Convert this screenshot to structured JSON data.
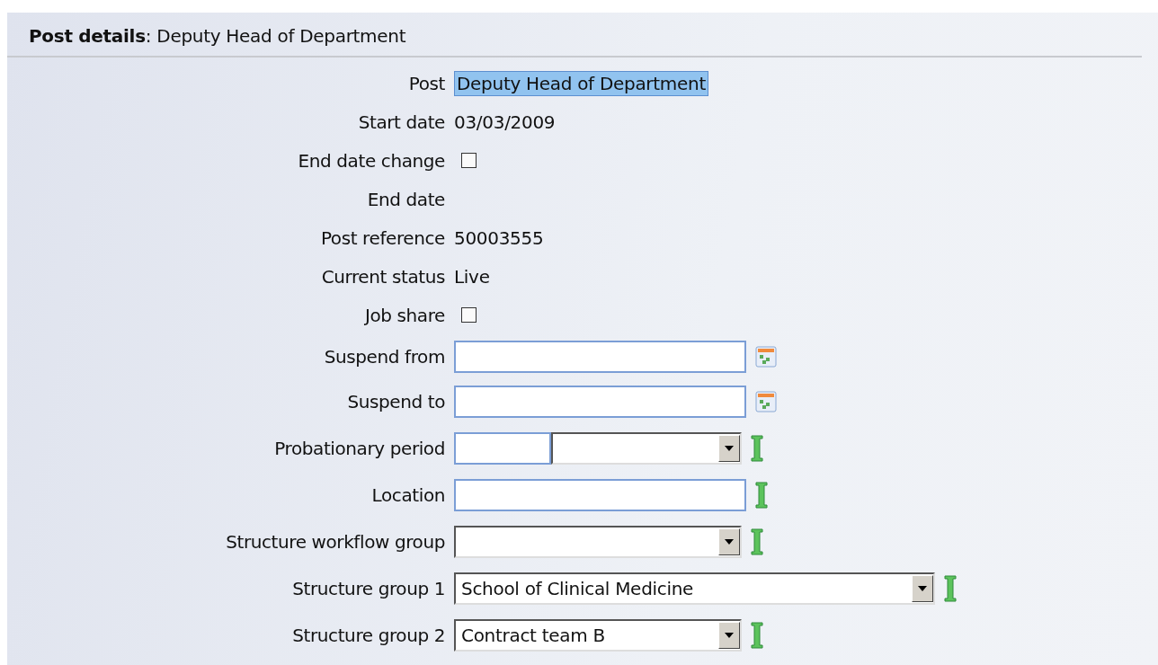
{
  "header": {
    "title": "**Post details**: Deputy Head of Department"
  },
  "fields": [
    {
      "kind": "highlight",
      "label": "Post",
      "value": "Deputy Head of Department"
    },
    {
      "kind": "text",
      "label": "Start date",
      "value": "03/03/2009"
    },
    {
      "kind": "checkbox",
      "label": "End date change",
      "checked": false
    },
    {
      "kind": "text",
      "label": "End date"
    },
    {
      "kind": "text",
      "label": "Post reference",
      "value": "50003555"
    },
    {
      "kind": "text",
      "label": "Current status",
      "value": "Live"
    },
    {
      "kind": "checkbox",
      "label": "Job share",
      "checked": false
    },
    {
      "kind": "date",
      "label": "Suspend from"
    },
    {
      "kind": "date",
      "label": "Suspend to"
    },
    {
      "kind": "combo",
      "label": "Probationary period",
      "required": true
    },
    {
      "kind": "input",
      "label": "Location",
      "required": true
    },
    {
      "kind": "select",
      "label": "Structure workflow group",
      "required": true
    },
    {
      "kind": "select",
      "label": "Structure group 1",
      "value": "School of Clinical Medicine",
      "wide": true,
      "required": true
    },
    {
      "kind": "select",
      "label": "Structure group 2",
      "value": "Contract team B",
      "required": true
    }
  ]
}
